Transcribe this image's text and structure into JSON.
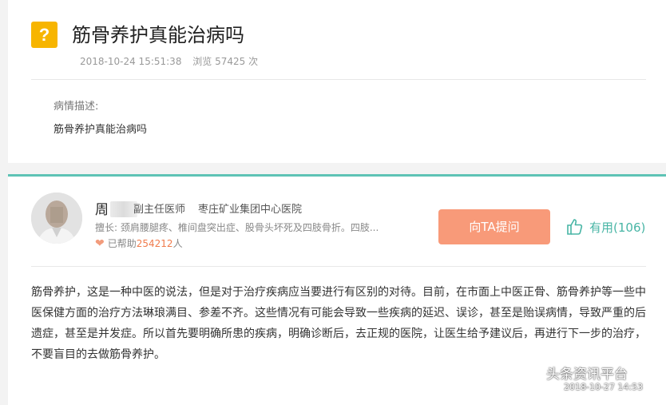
{
  "question": {
    "icon": "question-mark-icon",
    "icon_glyph": "?",
    "title": "筋骨养护真能治病吗",
    "datetime": "2018-10-24 15:51:38",
    "views": "浏览 57425 次",
    "description_label": "病情描述:",
    "description_text": "筋骨养护真能治病吗"
  },
  "doctor": {
    "name_visible": "周",
    "title": "副主任医师",
    "hospital": "枣庄矿业集团中心医院",
    "specialty": "擅长: 颈肩腰腿疼、椎间盘突出症、股骨头坏死及四肢骨折。四肢...",
    "helped_prefix": "已帮助",
    "helped_count": "254212",
    "helped_suffix": "人"
  },
  "actions": {
    "ask_label": "向TA提问",
    "useful_label": "有用(106)"
  },
  "answer": {
    "text": "筋骨养护，这是一种中医的说法，但是对于治疗疾病应当要进行有区别的对待。目前，在市面上中医正骨、筋骨养护等一些中医保健方面的治疗方法琳琅满目、参差不齐。这些情况有可能会导致一些疾病的延迟、误诊，甚至是贻误病情，导致严重的后遗症，甚至是并发症。所以首先要明确所患的疾病，明确诊断后，去正规的医院，让医生给予建议后，再进行下一步的治疗，不要盲目的去做筋骨养护。"
  },
  "watermark": {
    "text": "头条资讯平台",
    "timestamp": "2018-10-27 14:53"
  },
  "colors": {
    "accent_teal": "#5ec3b5",
    "ask_button": "#f89a79",
    "question_icon": "#f7b500",
    "helped_count": "#f07b4c"
  }
}
